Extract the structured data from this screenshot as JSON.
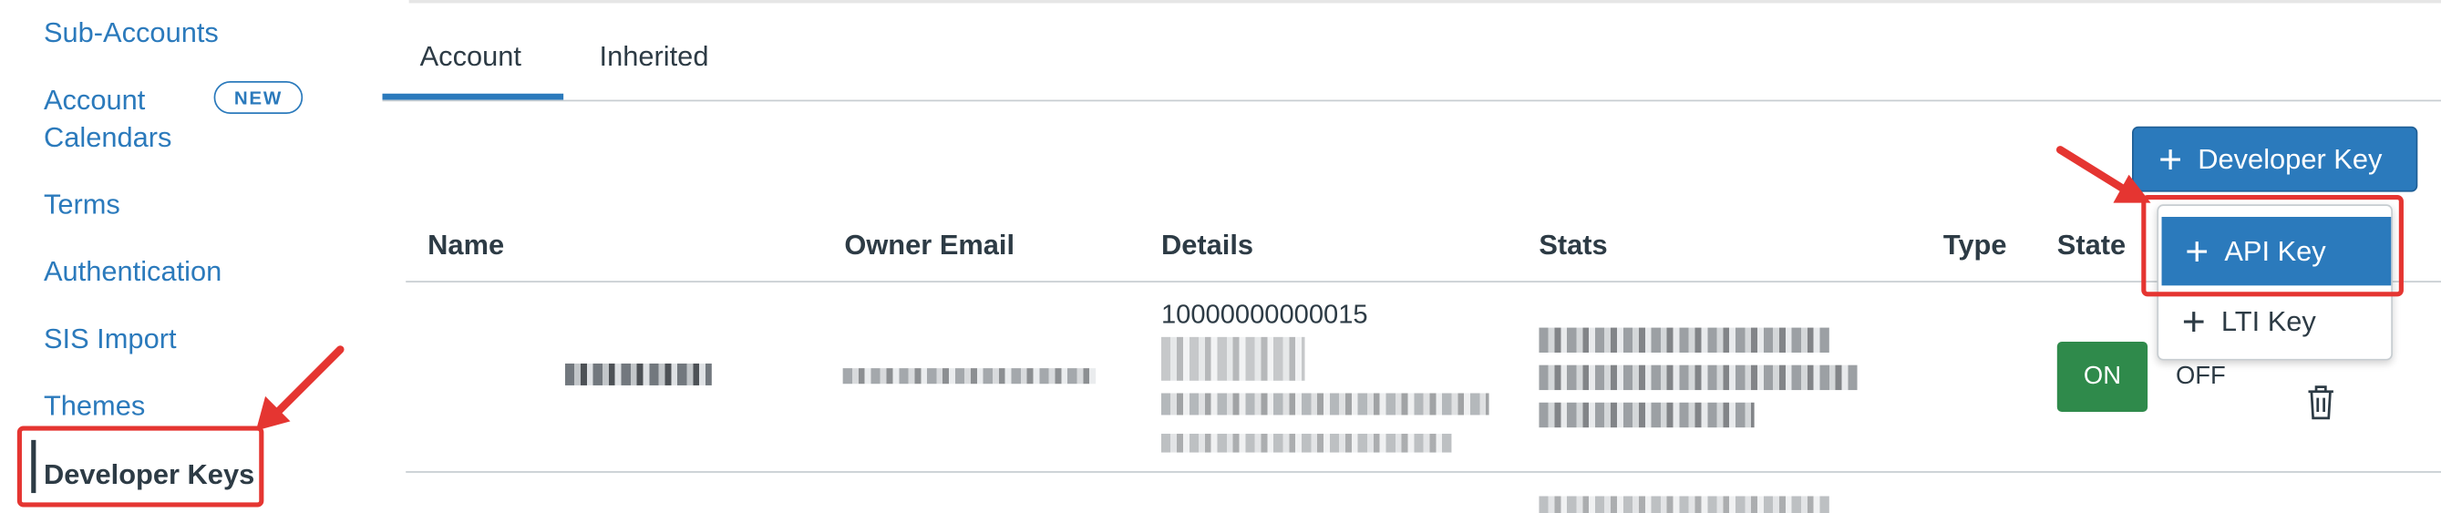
{
  "sidebar": {
    "items": [
      {
        "label": "Sub-Accounts"
      },
      {
        "label": "Account"
      },
      {
        "label": "Calendars"
      },
      {
        "label": "Terms"
      },
      {
        "label": "Authentication"
      },
      {
        "label": "SIS Import"
      },
      {
        "label": "Themes"
      }
    ],
    "badge": "NEW",
    "active": "Developer Keys"
  },
  "tabs": [
    {
      "label": "Account"
    },
    {
      "label": "Inherited"
    }
  ],
  "toolbar": {
    "developer_key_label": "Developer Key"
  },
  "menu": {
    "items": [
      {
        "label": "API Key"
      },
      {
        "label": "LTI Key"
      }
    ]
  },
  "table": {
    "columns": [
      "Name",
      "Owner Email",
      "Details",
      "Stats",
      "Type",
      "State"
    ],
    "rows": [
      {
        "details_id": "10000000000015",
        "state_on": "ON",
        "state_off": "OFF"
      }
    ]
  },
  "colors": {
    "accent": "#2b7abc",
    "on": "#2f8a4b",
    "annotation": "#e53531"
  }
}
